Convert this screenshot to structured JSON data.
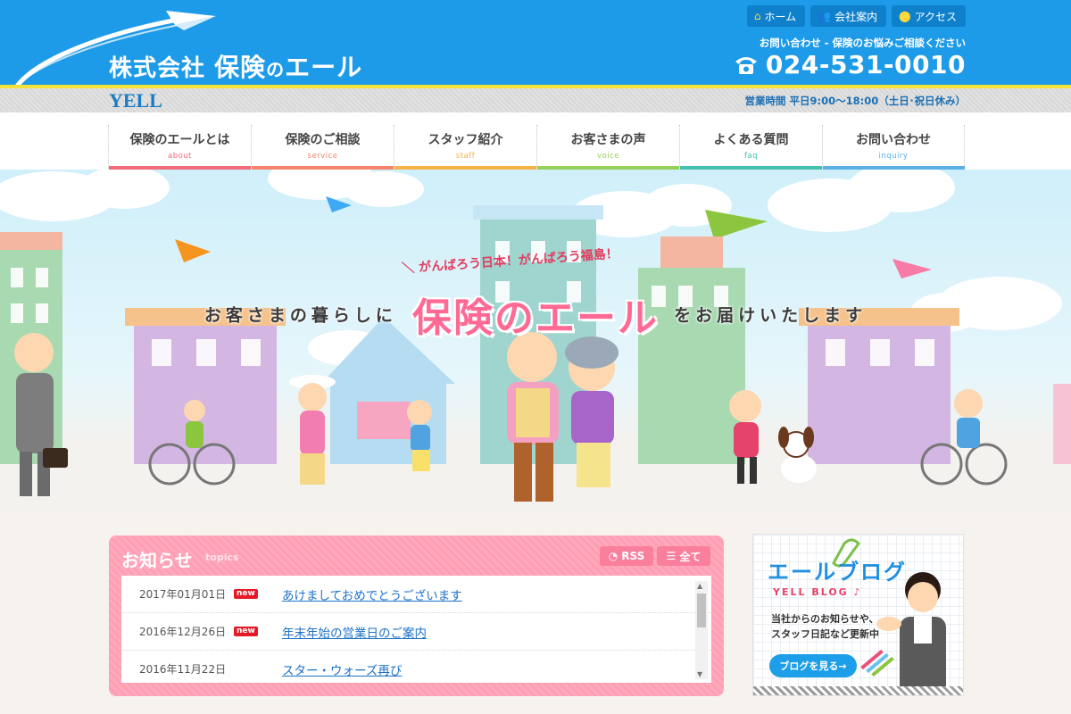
{
  "header": {
    "company_prefix": "株式会社",
    "company_name": "保険",
    "company_particle": "の",
    "company_suffix": "エール",
    "logo_sub": "YELL",
    "top_links": [
      {
        "label": "ホーム",
        "icon": "home-icon"
      },
      {
        "label": "会社案内",
        "icon": "people-icon"
      },
      {
        "label": "アクセス",
        "icon": "map-pin-icon"
      }
    ],
    "contact_label": "お問い合わせ - 保険のお悩みご相談ください",
    "phone": "024-531-0010",
    "hours": "営業時間 平日9:00～18:00（土日･祝日休み）"
  },
  "nav": {
    "items": [
      {
        "label": "保険のエールとは",
        "en": "about",
        "color": "#f26b7a"
      },
      {
        "label": "保険のご相談",
        "en": "service",
        "color": "#f6836e"
      },
      {
        "label": "スタッフ紹介",
        "en": "staff",
        "color": "#f7b24a"
      },
      {
        "label": "お客さまの声",
        "en": "voice",
        "color": "#97cf5a"
      },
      {
        "label": "よくある質問",
        "en": "faq",
        "color": "#45c0b0"
      },
      {
        "label": "お問い合わせ",
        "en": "inquiry",
        "color": "#5bb0e4"
      }
    ]
  },
  "hero": {
    "slogan": "＼ がんばろう日本！がんばろう福島！",
    "line_lead": "お客さまの暮らしに",
    "line_brand": "保険のエール",
    "line_tail": "をお届けいたします"
  },
  "topics": {
    "title": "お知らせ",
    "subtitle": "topics",
    "rss_label": "RSS",
    "all_label": "全て",
    "new_label": "new",
    "rows": [
      {
        "date": "2017年01月01日",
        "is_new": true,
        "title": "あけましておめでとうございます"
      },
      {
        "date": "2016年12月26日",
        "is_new": true,
        "title": "年末年始の営業日のご案内"
      },
      {
        "date": "2016年11月22日",
        "is_new": false,
        "title": "スター・ウォーズ再び"
      }
    ]
  },
  "blog": {
    "title": "エールブログ",
    "subtitle": "YELL BLOG ♪",
    "desc_line1": "当社からのお知らせや、",
    "desc_line2": "スタッフ日記など更新中",
    "button": "ブログを見る→"
  },
  "colors": {
    "header_blue": "#1e9be8",
    "brand_pink": "#ff6a95",
    "topics_pink": "#ff9eb3",
    "link_blue": "#1d72c8"
  }
}
